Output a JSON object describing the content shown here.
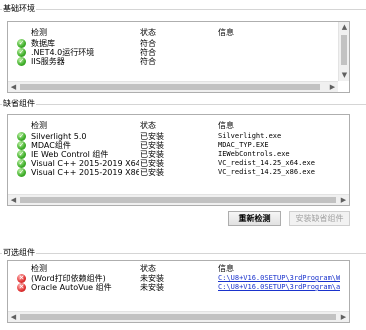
{
  "basic": {
    "title": "基础环境",
    "headers": {
      "check": "检测",
      "status": "状态",
      "info": "信息"
    },
    "rows": [
      {
        "name": "数据库",
        "status": "符合",
        "info": "",
        "icon": "check-icon"
      },
      {
        "name": ".NET4.0运行环境",
        "status": "符合",
        "info": "",
        "icon": "check-icon"
      },
      {
        "name": "IIS服务器",
        "status": "符合",
        "info": "",
        "icon": "check-icon"
      }
    ]
  },
  "missing": {
    "title": "缺省组件",
    "headers": {
      "check": "检测",
      "status": "状态",
      "info": "信息"
    },
    "rows": [
      {
        "name": "Silverlight 5.0",
        "status": "已安装",
        "info": "Silverlight.exe",
        "icon": "check-icon"
      },
      {
        "name": "MDAC组件",
        "status": "已安装",
        "info": "MDAC_TYP.EXE",
        "icon": "check-icon"
      },
      {
        "name": "IE Web Control 组件",
        "status": "已安装",
        "info": "IEWebControls.exe",
        "icon": "check-icon"
      },
      {
        "name": "Visual C++ 2015-2019 X64...",
        "status": "已安装",
        "info": "VC_redist_14.25_x64.exe",
        "icon": "check-icon"
      },
      {
        "name": "Visual C++ 2015-2019 X86...",
        "status": "已安装",
        "info": "VC_redist_14.25_x86.exe",
        "icon": "check-icon"
      }
    ],
    "recheck_label": "重新检测",
    "install_label": "安装缺省组件"
  },
  "optional": {
    "title": "可选组件",
    "headers": {
      "check": "检测",
      "status": "状态",
      "info": "信息"
    },
    "rows": [
      {
        "name": "(Word打印依赖组件)",
        "status": "未安装",
        "info": "C:\\U8+V16.0SETUP\\3rdProgram\\Wo...",
        "icon": "error-icon"
      },
      {
        "name": "Oracle AutoVue 组件",
        "status": "未安装",
        "info": "C:\\U8+V16.0SETUP\\3rdProgram\\av...",
        "icon": "error-icon"
      }
    ]
  }
}
